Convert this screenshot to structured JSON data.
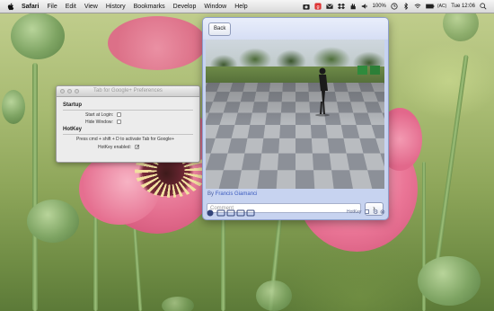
{
  "menubar": {
    "items": [
      "Safari",
      "File",
      "Edit",
      "View",
      "History",
      "Bookmarks",
      "Develop",
      "Window",
      "Help"
    ],
    "battery": "100%",
    "clock": "Tue 12:06",
    "icons": [
      "camera-icon",
      "app-icon-red",
      "mail-icon",
      "dropbox-icon",
      "hand-icon",
      "volume-icon",
      "wifi-icon",
      "battery-icon",
      "search-icon"
    ]
  },
  "prefs": {
    "title": "Tab for Google+ Preferences",
    "startup_heading": "Startup",
    "start_at_login": "Start at Login:",
    "hide_window": "Hide Window:",
    "hotkey_heading": "HotKey",
    "hotkey_instructions": "Press cmd + shift + D to activate Tab for Google+",
    "hotkey_enabled": "HotKey enabled:",
    "start_at_login_checked": false,
    "hide_window_checked": false,
    "hotkey_enabled_checked": true
  },
  "panel": {
    "back_label": "Back",
    "byline_prefix": "By",
    "author": "Francis Giamanci",
    "comment_placeholder": "Comment",
    "send_label": "›",
    "footer_label": "HotKey"
  },
  "colors": {
    "panel_bg": "#c7d3f0",
    "link": "#3b5bbf",
    "wallpaper_green": "#8ea65a",
    "poppy_pink": "#e8708f"
  }
}
